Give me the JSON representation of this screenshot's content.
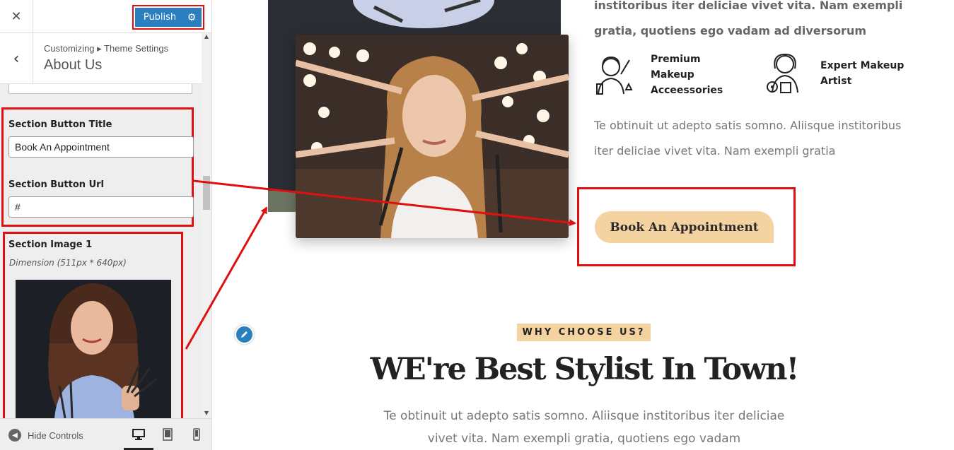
{
  "customizer": {
    "close_symbol": "✕",
    "publish_label": "Publish",
    "breadcrumb": "Customizing ▸ Theme Settings",
    "section_title": "About Us",
    "button_title_label": "Section Button Title",
    "button_title_value": "Book An Appointment",
    "button_url_label": "Section Button Url",
    "button_url_value": "#",
    "image_label": "Section Image 1",
    "image_dimension": "Dimension (511px * 640px)",
    "hide_controls": "Hide Controls"
  },
  "preview": {
    "intro_bold_line1": "institoribus iter deliciae vivet vita. Nam exempli",
    "intro_bold_line2": "gratia, quotiens ego vadam ad diversorum",
    "features": [
      {
        "icon": "makeup-accessories-icon",
        "label": "Premium Makeup Acceessories"
      },
      {
        "icon": "makeup-artist-icon",
        "label": "Expert Makeup Artist"
      }
    ],
    "paragraph": "Te obtinuit ut adepto satis somno. Aliisque institoribus iter deliciae vivet vita. Nam exempli gratia",
    "cta_label": "Book An Appointment",
    "why_badge": "WHY CHOOSE US?",
    "why_title": "WE're Best Stylist In Town!",
    "why_paragraph": "Te obtinuit ut adepto satis somno. Aliisque institoribus iter deliciae vivet vita. Nam exempli gratia, quotiens ego vadam"
  },
  "colors": {
    "publish_blue": "#2b7fbf",
    "highlight_red": "#e01010",
    "accent_peach": "#f5d3a0"
  }
}
